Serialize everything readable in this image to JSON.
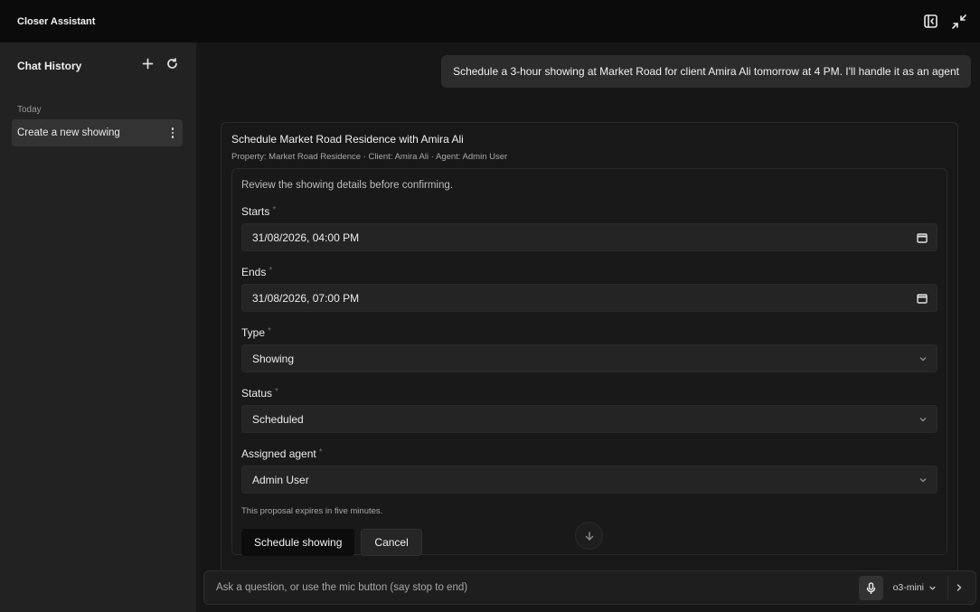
{
  "app": {
    "title": "Closer Assistant"
  },
  "sidebar": {
    "title": "Chat History",
    "section_label": "Today",
    "items": [
      {
        "label": "Create a new showing"
      }
    ]
  },
  "chat": {
    "user_message": "Schedule a 3-hour showing at Market Road for client Amira Ali tomorrow at 4 PM. I'll handle it as an agent"
  },
  "proposal": {
    "title": "Schedule Market Road Residence with Amira Ali",
    "subtitle": "Property: Market Road Residence · Client: Amira Ali · Agent: Admin User",
    "intro": "Review the showing details before confirming.",
    "required_mark": "*",
    "fields": {
      "starts": {
        "label": "Starts",
        "value": "31/08/2026, 04:00 PM"
      },
      "ends": {
        "label": "Ends",
        "value": "31/08/2026, 07:00 PM"
      },
      "type": {
        "label": "Type",
        "value": "Showing"
      },
      "status": {
        "label": "Status",
        "value": "Scheduled"
      },
      "agent": {
        "label": "Assigned agent",
        "value": "Admin User"
      }
    },
    "expiry_note": "This proposal expires in five minutes.",
    "confirm_label": "Schedule showing",
    "cancel_label": "Cancel"
  },
  "composer": {
    "placeholder": "Ask a question, or use the mic button (say stop to end)",
    "model": "o3-mini"
  },
  "icons": {
    "topbar": [
      "sidebar-toggle-icon",
      "minimize-icon"
    ],
    "sidebar": [
      "plus-icon",
      "refresh-icon",
      "kebab-menu-icon"
    ],
    "fields": [
      "calendar-icon",
      "chevron-down-icon"
    ],
    "composer": [
      "mic-icon",
      "chevron-down-icon",
      "chevron-right-icon"
    ],
    "scroll": "arrow-down-icon"
  }
}
